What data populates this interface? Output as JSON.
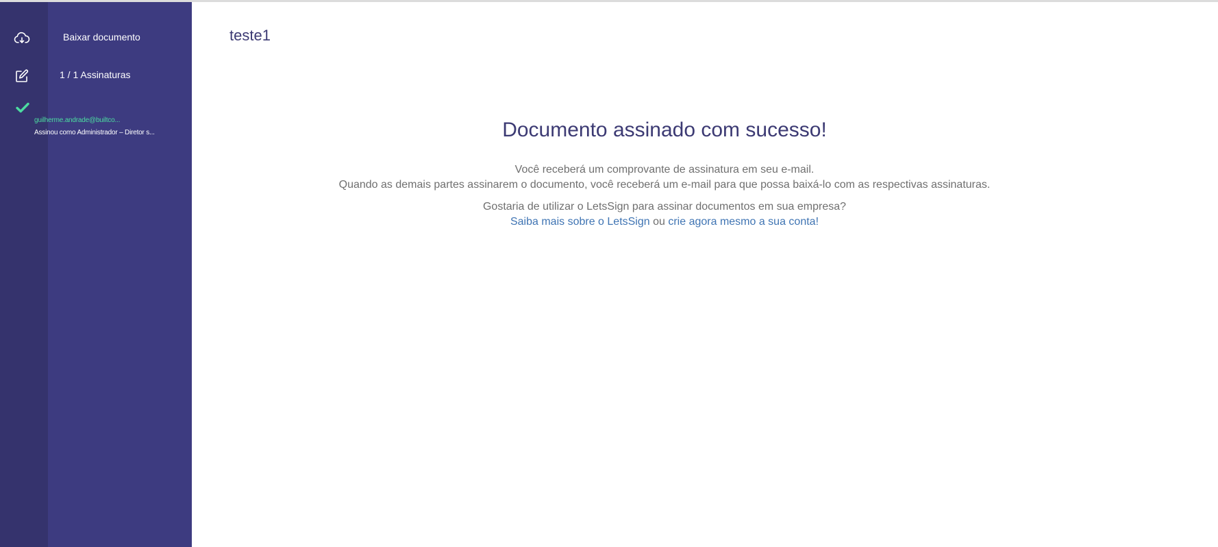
{
  "sidebar": {
    "download_label": "Baixar documento",
    "signatures_label": "1 / 1 Assinaturas",
    "signer": {
      "email": "guilherme.andrade@builtco...",
      "role": "Assinou como Administrador – Diretor s..."
    },
    "icons": {
      "download": "cloud-download-icon",
      "signatures": "edit-icon",
      "status": "check-icon"
    }
  },
  "main": {
    "document_title": "teste1",
    "heading": "Documento assinado com sucesso!",
    "line1": "Você receberá um comprovante de assinatura em seu e-mail.",
    "line2": "Quando as demais partes assinarem o documento, você receberá um e-mail para que possa baixá-lo com as respectivas assinaturas.",
    "line3": "Gostaria de utilizar o LetsSign para assinar documentos em sua empresa?",
    "link_learn_more": "Saiba mais sobre o LetsSign",
    "connector": " ou ",
    "link_create_account": "crie agora mesmo a sua conta!"
  },
  "colors": {
    "sidebar_bg": "#3d3b80",
    "rail_bg": "#35336d",
    "signer_email": "#4cdba0",
    "heading": "#3c3a73",
    "body_text": "#6f6f6f",
    "link": "#3f74b3"
  }
}
